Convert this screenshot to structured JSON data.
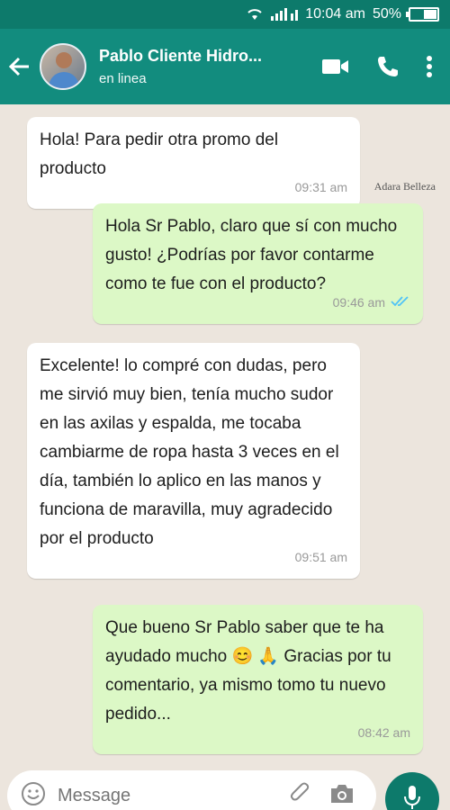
{
  "status_bar": {
    "time": "10:04 am",
    "battery": "50%"
  },
  "header": {
    "contact_name": "Pablo Cliente Hidro...",
    "presence": "en linea"
  },
  "watermark": "Adara Belleza",
  "messages": [
    {
      "direction": "in",
      "text": "Hola! Para pedir otra promo del producto",
      "time": "09:31 am"
    },
    {
      "direction": "out",
      "text": "Hola Sr Pablo, claro que sí con mucho gusto! ¿Podrías por favor contarme como te fue con el producto?",
      "time": "09:46 am",
      "read": true
    },
    {
      "direction": "in",
      "text": "Excelente! lo compré con dudas, pero me sirvió muy bien, tenía mucho sudor en las axilas y espalda, me tocaba cambiarme de ropa hasta 3 veces en el día, también lo aplico en las manos y funciona de maravilla, muy agradecido por el producto",
      "time": "09:51 am"
    },
    {
      "direction": "out",
      "text": "Que bueno Sr Pablo saber que te ha ayudado mucho 😊 🙏  Gracias por tu comentario, ya mismo tomo tu nuevo pedido...",
      "time": "08:42 am"
    }
  ],
  "input": {
    "placeholder": "Message"
  },
  "colors": {
    "header": "#128c7e",
    "status_bar": "#0d7a6b",
    "incoming": "#ffffff",
    "outgoing": "#dcf8c6",
    "read_ticks": "#4fc3f7"
  }
}
